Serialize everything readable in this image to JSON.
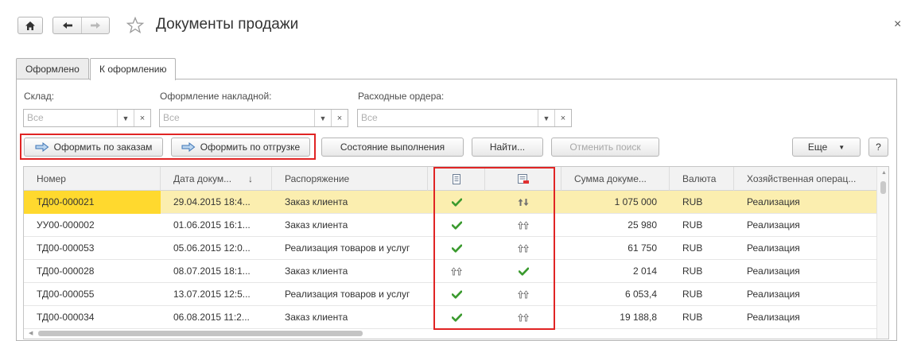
{
  "header": {
    "title": "Документы продажи",
    "close_label": "×"
  },
  "tabs": [
    {
      "label": "Оформлено",
      "active": false
    },
    {
      "label": "К оформлению",
      "active": true
    }
  ],
  "filters": [
    {
      "label": "Склад:",
      "placeholder": "Все"
    },
    {
      "label": "Оформление накладной:",
      "placeholder": "Все"
    },
    {
      "label": "Расходные ордера:",
      "placeholder": "Все"
    }
  ],
  "toolbar": {
    "by_orders": "Оформить по заказам",
    "by_shipment": "Оформить по отгрузке",
    "status": "Состояние выполнения",
    "find": "Найти...",
    "cancel_search": "Отменить поиск",
    "more": "Еще",
    "help": "?"
  },
  "table": {
    "columns": {
      "number": "Номер",
      "date": "Дата докум...",
      "date_sort": "↓",
      "order": "Распоряжение",
      "sum": "Сумма докуме...",
      "currency": "Валюта",
      "operation": "Хозяйственная операц..."
    },
    "rows": [
      {
        "number": "ТД00-000021",
        "date": "29.04.2015 18:4...",
        "order": "Заказ клиента",
        "invoice": "check",
        "orders": "arrows-updown",
        "sum": "1 075 000",
        "currency": "RUB",
        "operation": "Реализация"
      },
      {
        "number": "УУ00-000002",
        "date": "01.06.2015 16:1...",
        "order": "Заказ клиента",
        "invoice": "check",
        "orders": "double-up",
        "sum": "25 980",
        "currency": "RUB",
        "operation": "Реализация"
      },
      {
        "number": "ТД00-000053",
        "date": "05.06.2015 12:0...",
        "order": "Реализация товаров и услуг",
        "invoice": "check",
        "orders": "double-up",
        "sum": "61 750",
        "currency": "RUB",
        "operation": "Реализация"
      },
      {
        "number": "ТД00-000028",
        "date": "08.07.2015 18:1...",
        "order": "Заказ клиента",
        "invoice": "double-up",
        "orders": "check",
        "sum": "2 014",
        "currency": "RUB",
        "operation": "Реализация"
      },
      {
        "number": "ТД00-000055",
        "date": "13.07.2015 12:5...",
        "order": "Реализация товаров и услуг",
        "invoice": "check",
        "orders": "double-up",
        "sum": "6 053,4",
        "currency": "RUB",
        "operation": "Реализация"
      },
      {
        "number": "ТД00-000034",
        "date": "06.08.2015 11:2...",
        "order": "Заказ клиента",
        "invoice": "check",
        "orders": "double-up",
        "sum": "19 188,8",
        "currency": "RUB",
        "operation": "Реализация"
      }
    ]
  },
  "colors": {
    "highlight_box": "#e02424",
    "selected_row": "#fbeeaf",
    "current_cell": "#ffd92e",
    "check": "#3a9a2e"
  }
}
